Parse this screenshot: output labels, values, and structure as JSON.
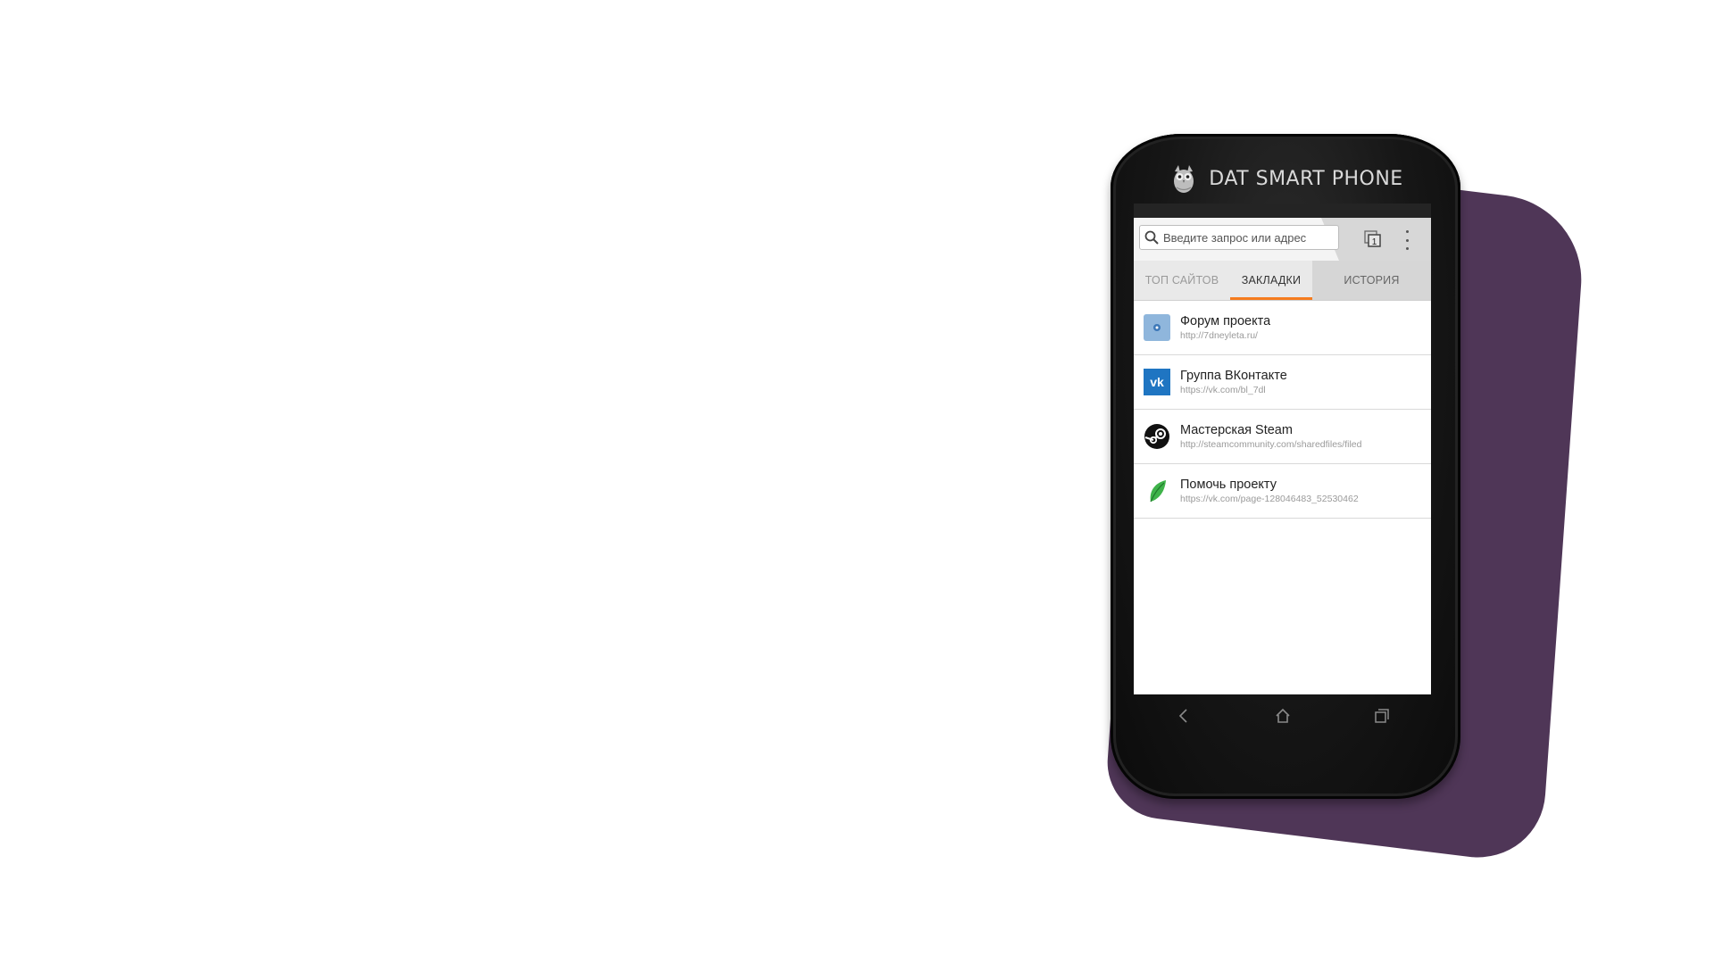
{
  "device": {
    "brand_name": "DAT SMART PHONE"
  },
  "colors": {
    "accent": "#f57c1f",
    "purple_card": "#4f3657",
    "phone_body": "#161616"
  },
  "browser": {
    "search": {
      "placeholder": "Введите запрос или адрес",
      "icon": "search-icon"
    },
    "tabs_count": "1",
    "menu_icon": "overflow-menu-icon"
  },
  "tabs": [
    {
      "label": "ТОП САЙТОВ",
      "active": false
    },
    {
      "label": "ЗАКЛАДКИ",
      "active": true
    },
    {
      "label": "ИСТОРИЯ",
      "active": false
    }
  ],
  "bookmarks": [
    {
      "title": "Форум проекта",
      "url": "http://7dneyleta.ru/",
      "icon": "forum-icon"
    },
    {
      "title": "Группа ВКонтакте",
      "url": "https://vk.com/bl_7dl",
      "icon": "vk-icon"
    },
    {
      "title": "Мастерская Steam",
      "url": "http://steamcommunity.com/sharedfiles/filed",
      "icon": "steam-icon"
    },
    {
      "title": "Помочь проекту",
      "url": "https://vk.com/page-128046483_52530462",
      "icon": "leaf-icon"
    }
  ],
  "nav": {
    "back_icon": "back-icon",
    "home_icon": "home-icon",
    "recents_icon": "recents-icon"
  }
}
